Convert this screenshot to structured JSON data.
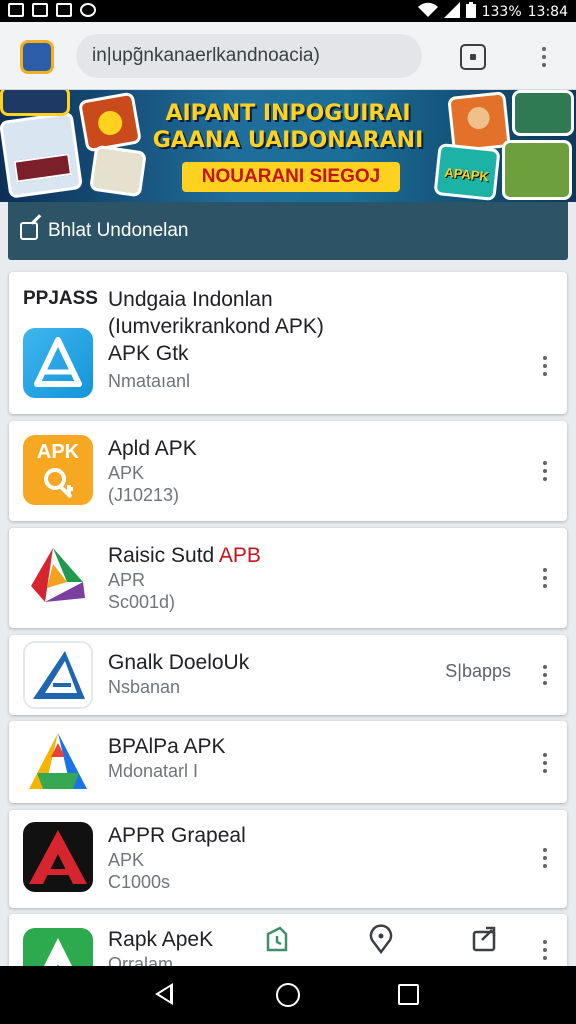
{
  "status_bar": {
    "battery": "133%",
    "time": "13:84"
  },
  "browser": {
    "url": "in|upg̃nkanaerlkandnoacia)"
  },
  "banner": {
    "title_line1": "AIPANT INPOGUIRAI",
    "title_line2": "GAANA UAIDONARANI",
    "subtitle": "NOUARANI SIEGOJ",
    "thumb_label": "APAPK"
  },
  "category_bar": {
    "label": "Bhlat Undonelan"
  },
  "apps": [
    {
      "badge": "PPJASS",
      "title": "Undgaia Indonlan",
      "title2": "(Iumverikrankond APK)",
      "sub1": "APK Gtk",
      "sub2": "Nmataıanl",
      "icon": "a-blue-icon"
    },
    {
      "title": "Apld APK",
      "sub1": "APK",
      "sub2": "(J10213)",
      "icon": "apk-orange-icon",
      "icon_text": "APK"
    },
    {
      "title": "Raisic Sutd ",
      "title_accent": "APB",
      "sub1": "APR",
      "sub2": "Sc001d)",
      "icon": "triangle-red-green-icon"
    },
    {
      "title": "Gnalk DoeloUk",
      "sub1": "Nsbanan",
      "tag": "S|bapps",
      "icon": "a-outline-blue-icon"
    },
    {
      "title": "BPAlPa APK",
      "sub1": "Mdonatarl I",
      "icon": "a-gradient-icon"
    },
    {
      "title": "APPR Grapeal",
      "sub1": "APK",
      "sub2": "C1000s",
      "icon": "a-red-dark-icon"
    },
    {
      "title": "Rapk ApeK",
      "sub1": "Orralam",
      "icon": "a-green-icon"
    }
  ],
  "colors": {
    "accent_dark": "#2d5466",
    "banner_yellow": "#ffd21f",
    "accent_red": "#c4141b"
  }
}
